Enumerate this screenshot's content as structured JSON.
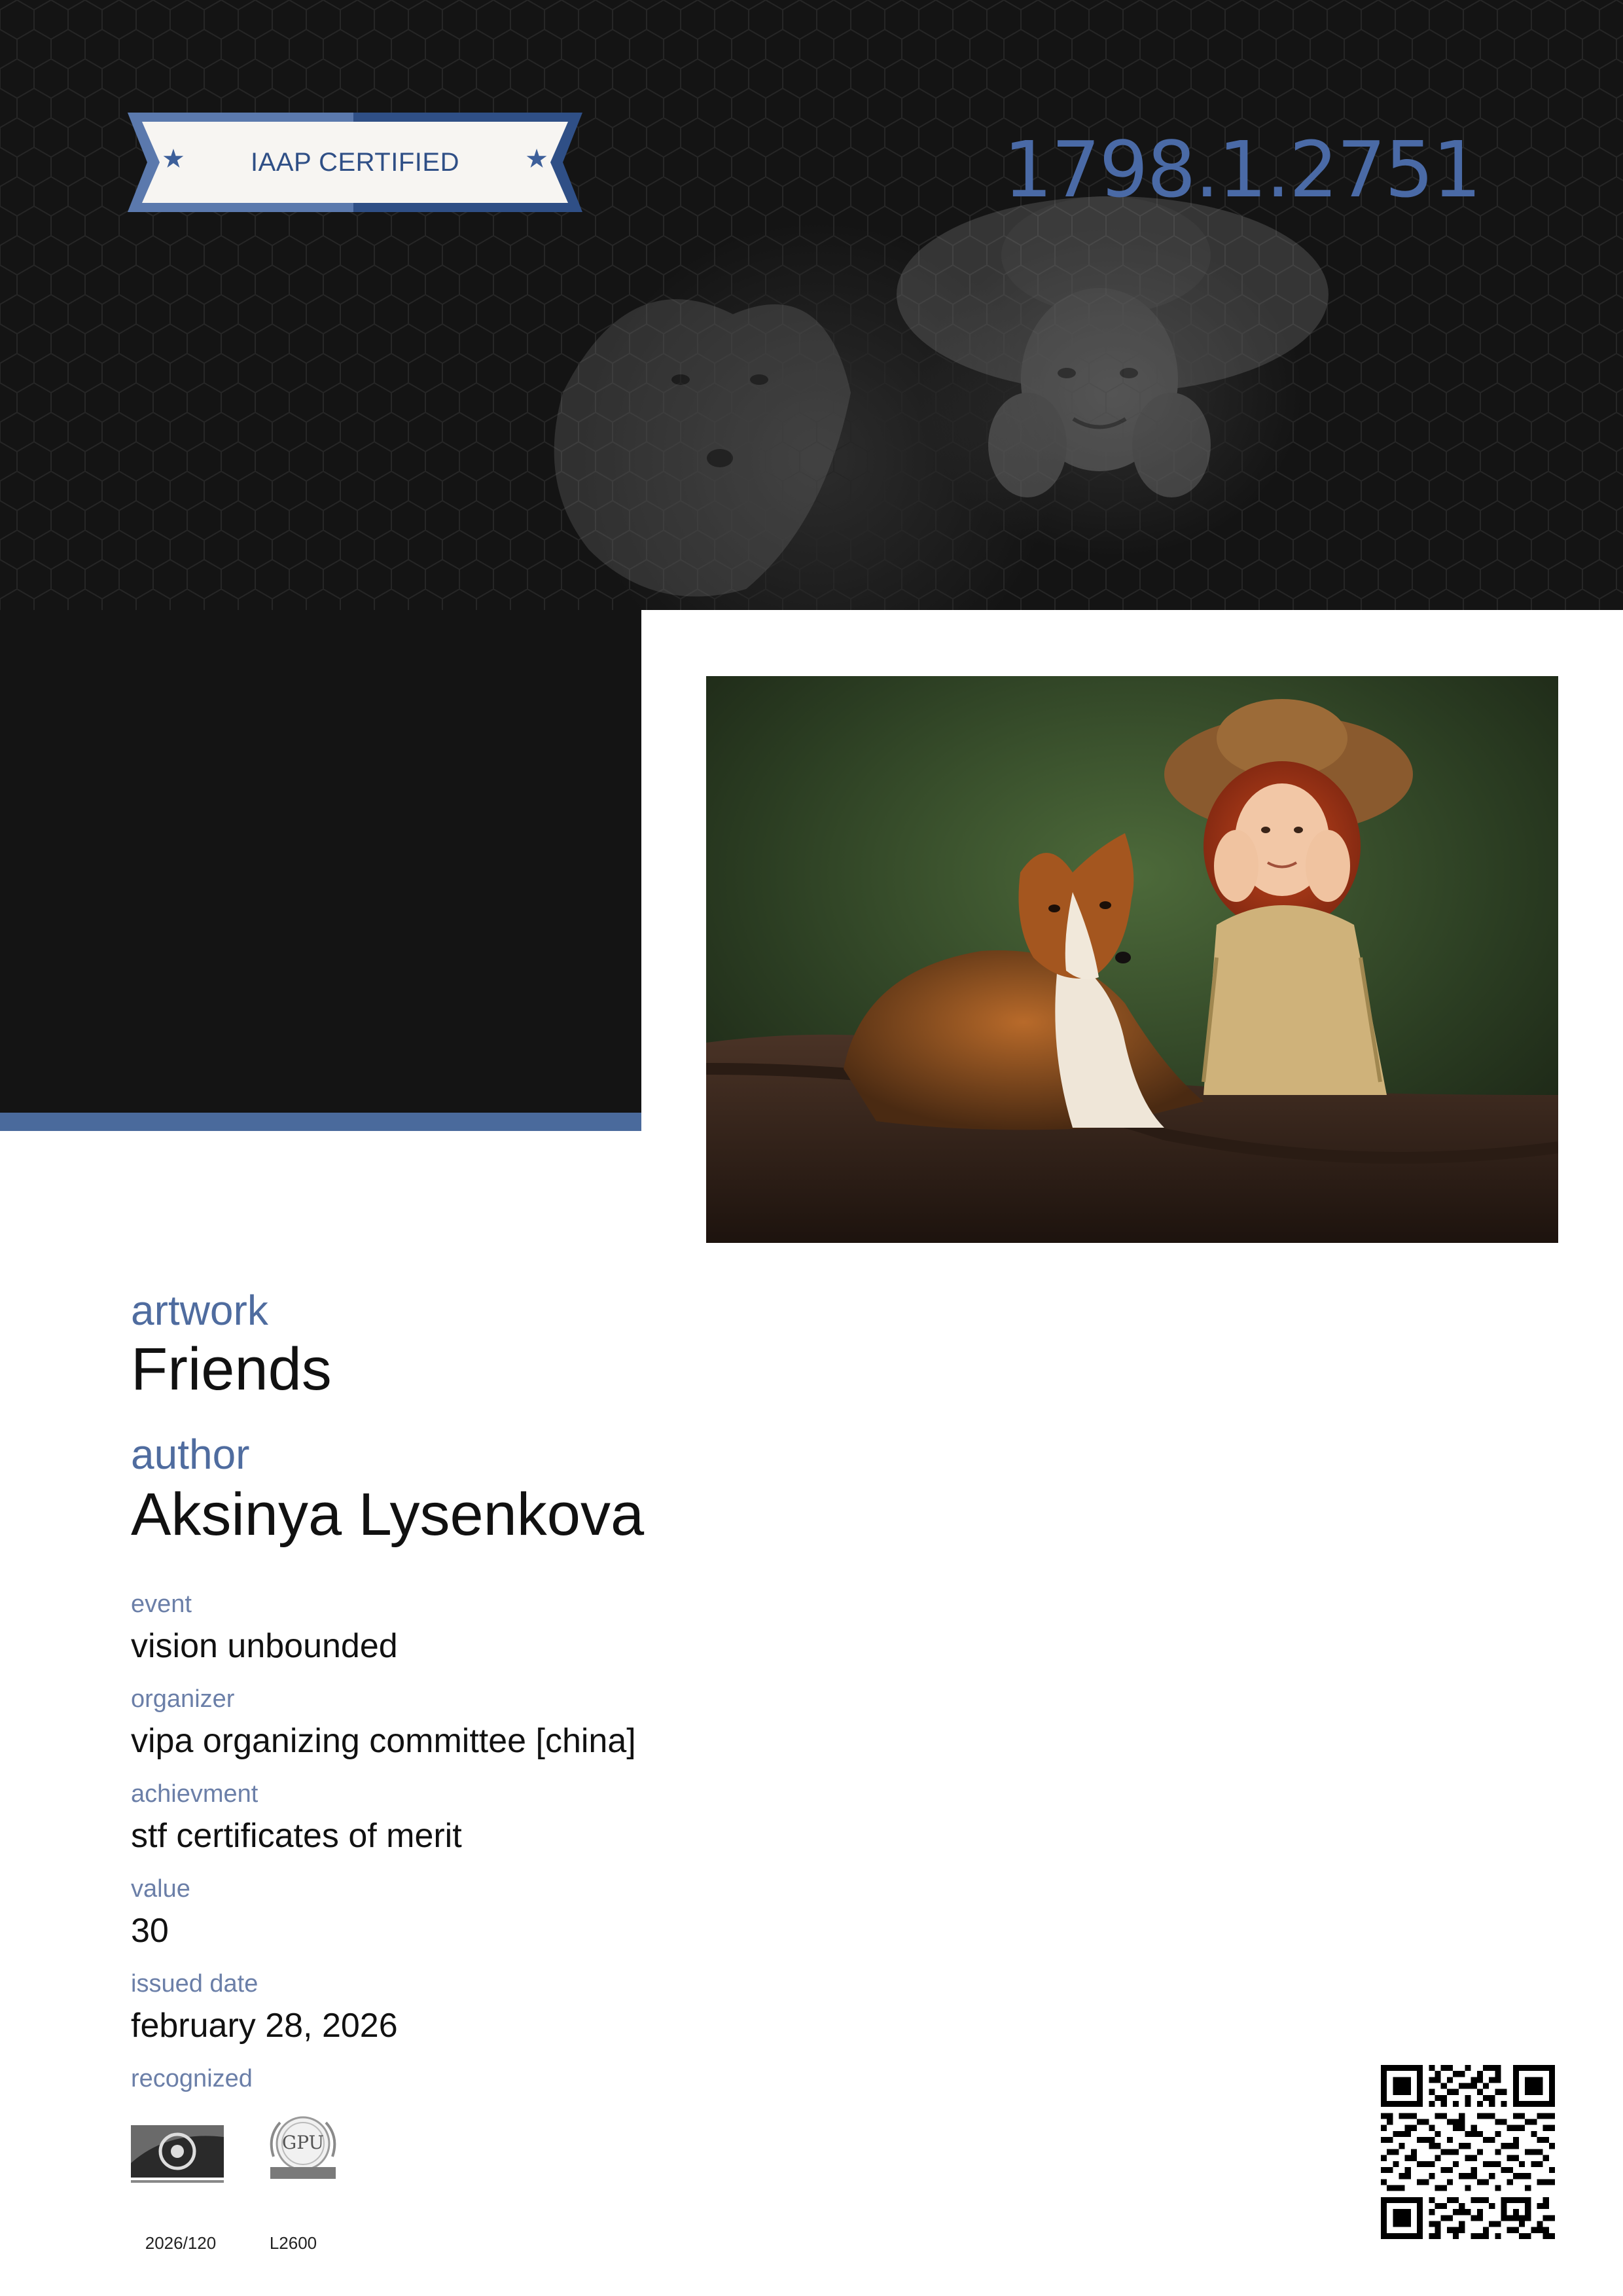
{
  "badge": {
    "label": "IAAP CERTIFIED"
  },
  "certificate_number": "1798.1.2751",
  "colors": {
    "accent_blue": "#4a6a9c",
    "hero_dark": "#141414",
    "label_blue": "#4f6c9f"
  },
  "artwork": {
    "label": "artwork",
    "value": "Friends"
  },
  "author": {
    "label": "author",
    "value": "Aksinya Lysenkova"
  },
  "details": [
    {
      "label": "event",
      "value": "vision unbounded"
    },
    {
      "label": "organizer",
      "value": "vipa organizing committee [china]"
    },
    {
      "label": "achievment",
      "value": "stf certificates of merit"
    },
    {
      "label": "value",
      "value": "30"
    },
    {
      "label": "issued date",
      "value": "february 28, 2026"
    }
  ],
  "recognized": {
    "label": "recognized",
    "logos": [
      {
        "icon": "iaap-logo",
        "code": "2026/120"
      },
      {
        "icon": "gpu-logo",
        "text": "GPU",
        "code": "L2600"
      }
    ]
  },
  "qr": {
    "icon": "qr-code-icon"
  }
}
